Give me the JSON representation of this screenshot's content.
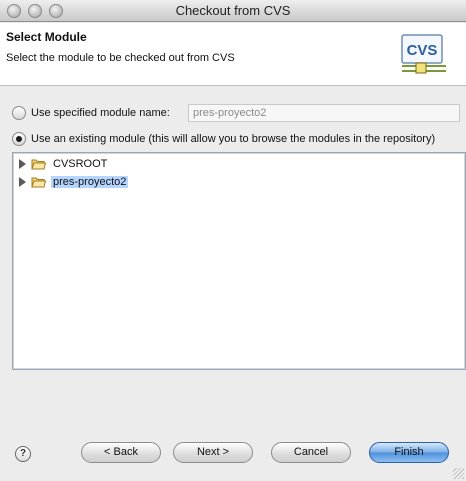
{
  "window": {
    "title": "Checkout from CVS"
  },
  "header": {
    "title": "Select Module",
    "description": "Select the module to be checked out from CVS",
    "logo_text": "CVS"
  },
  "options": {
    "specified_label": "Use specified module name:",
    "specified_value": "pres-proyecto2",
    "existing_label": "Use an existing module (this will allow you to browse the modules in the repository)",
    "selected": "existing"
  },
  "tree": {
    "items": [
      {
        "label": "CVSROOT",
        "selected": false
      },
      {
        "label": "pres-proyecto2",
        "selected": true
      }
    ]
  },
  "buttons": {
    "help": "?",
    "back": "< Back",
    "next": "Next >",
    "cancel": "Cancel",
    "finish": "Finish"
  },
  "colors": {
    "selection": "#b5d5ff",
    "default_button": "#4f8fdb"
  }
}
